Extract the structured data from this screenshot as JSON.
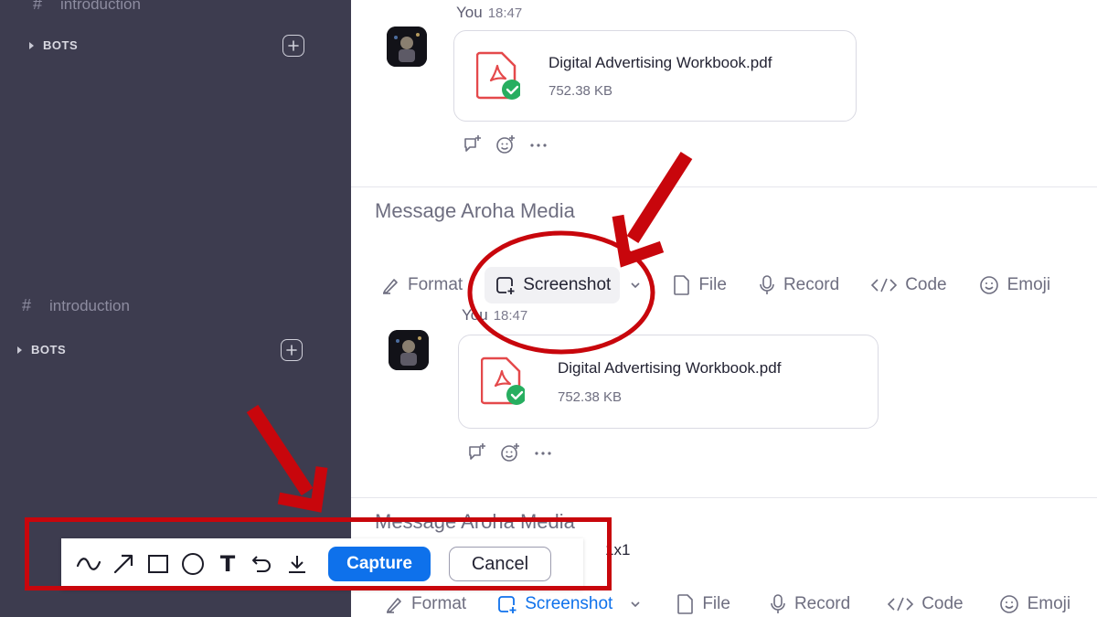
{
  "sidebar": {
    "channel_label": "introduction",
    "section_label": "BOTS"
  },
  "top_message": {
    "sender": "You",
    "time": "18:47",
    "file_name": "Digital Advertising Workbook.pdf",
    "file_size": "752.38 KB"
  },
  "bottom_message": {
    "sender": "You",
    "time": "18:47",
    "file_name": "Digital Advertising Workbook.pdf",
    "file_size": "752.38 KB"
  },
  "composer": {
    "placeholder": "Message Aroha Media",
    "toolbar": {
      "format": "Format",
      "screenshot": "Screenshot",
      "file": "File",
      "record": "Record",
      "code": "Code",
      "emoji": "Emoji"
    }
  },
  "capture_bar": {
    "capture_label": "Capture",
    "cancel_label": "Cancel",
    "size_label": "1x1",
    "text_tool_glyph": "T"
  },
  "colors": {
    "sidebar_bg": "#3d3c4f",
    "accent_blue": "#0e71eb",
    "annotation_red": "#c8060c",
    "pdf_red": "#e4494b",
    "check_green": "#27ae60"
  }
}
